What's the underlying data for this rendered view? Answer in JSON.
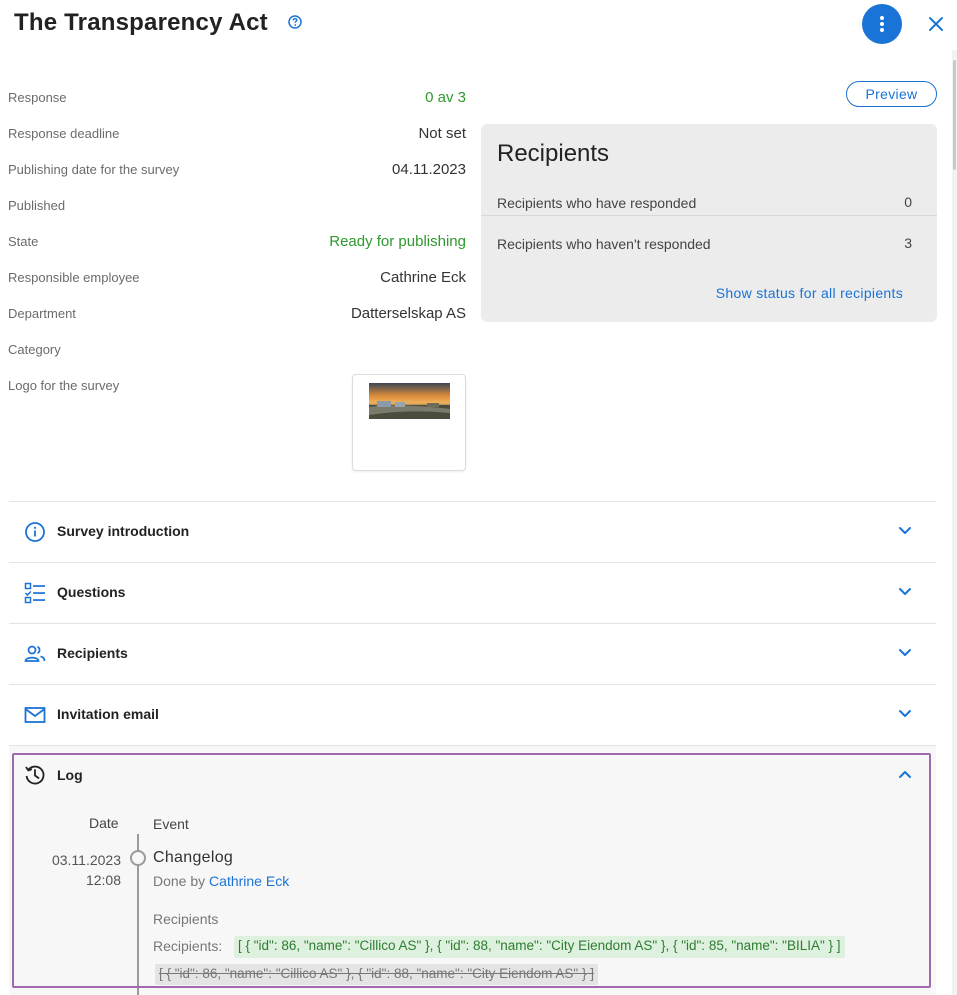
{
  "header": {
    "title": "The Transparency Act"
  },
  "details": [
    {
      "label": "Response",
      "value": "0 av 3",
      "color": "#2e9a2e"
    },
    {
      "label": "Response deadline",
      "value": "Not set"
    },
    {
      "label": "Publishing date for the survey",
      "value": "04.11.2023"
    },
    {
      "label": "Published",
      "value": ""
    },
    {
      "label": "State",
      "value": "Ready for publishing",
      "color": "#2e9a2e"
    },
    {
      "label": "Responsible employee",
      "value": "Cathrine Eck"
    },
    {
      "label": "Department",
      "value": "Datterselskap AS"
    },
    {
      "label": "Category",
      "value": ""
    },
    {
      "label": "Logo for the survey",
      "value": ""
    }
  ],
  "preview_label": "Preview",
  "recipients_card": {
    "title": "Recipients",
    "rows": [
      {
        "label": "Recipients who have responded",
        "value": "0"
      },
      {
        "label": "Recipients who haven't responded",
        "value": "3"
      }
    ],
    "link": "Show status for all recipients"
  },
  "sections": [
    {
      "label": "Survey introduction",
      "icon": "info-icon"
    },
    {
      "label": "Questions",
      "icon": "checklist-icon"
    },
    {
      "label": "Recipients",
      "icon": "people-icon"
    },
    {
      "label": "Invitation email",
      "icon": "mail-icon"
    }
  ],
  "log": {
    "label": "Log",
    "icon": "history-icon",
    "col_date": "Date",
    "col_event": "Event",
    "entry": {
      "date": "03.11.2023",
      "time": "12:08",
      "title": "Changelog",
      "done_by_prefix": "Done by",
      "done_by_name": "Cathrine Eck",
      "field_heading": "Recipients",
      "field_label": "Recipients:",
      "new_value": "[ { \"id\": 86, \"name\": \"Cillico AS\" }, { \"id\": 88, \"name\": \"City Eiendom AS\" }, { \"id\": 85, \"name\": \"BILIA\" } ]",
      "old_value": "[ { \"id\": 86, \"name\": \"Cillico AS\" }, { \"id\": 88, \"name\": \"City Eiendom AS\" } ]"
    }
  },
  "colors": {
    "accent": "#1a73d6",
    "success": "#2e9a2e",
    "highlight_border": "#a069ad"
  }
}
